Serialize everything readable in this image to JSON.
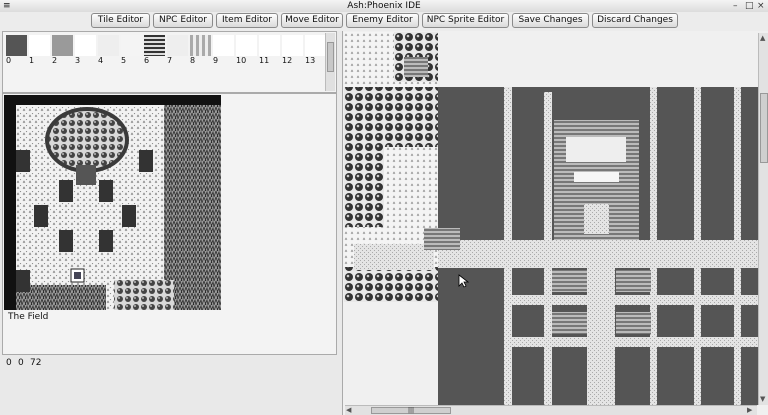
{
  "window": {
    "title": "Ash:Phoenix IDE",
    "menu_glyph": "≡",
    "min_glyph": "–",
    "max_glyph": "□",
    "close_glyph": "×"
  },
  "toolbar": {
    "tile_editor": "Tile Editor",
    "npc_editor": "NPC Editor",
    "item_editor": "Item Editor",
    "move_editor": "Move Editor",
    "enemy_editor": "Enemy Editor",
    "npc_sprite_editor": "NPC Sprite Editor",
    "save_changes": "Save Changes",
    "discard_changes": "Discard Changes"
  },
  "palette": {
    "tiles": [
      "0",
      "1",
      "2",
      "3",
      "4",
      "5",
      "6",
      "7",
      "8",
      "9",
      "10",
      "11",
      "12",
      "13"
    ]
  },
  "map": {
    "name": "The Field",
    "coord_x": "0",
    "coord_y": "0",
    "coord_z": "72"
  },
  "scroll": {
    "hthumb_label": "|||",
    "up_arrow": "▲",
    "down_arrow": "▼",
    "left_arrow": "◀",
    "right_arrow": "▶"
  }
}
